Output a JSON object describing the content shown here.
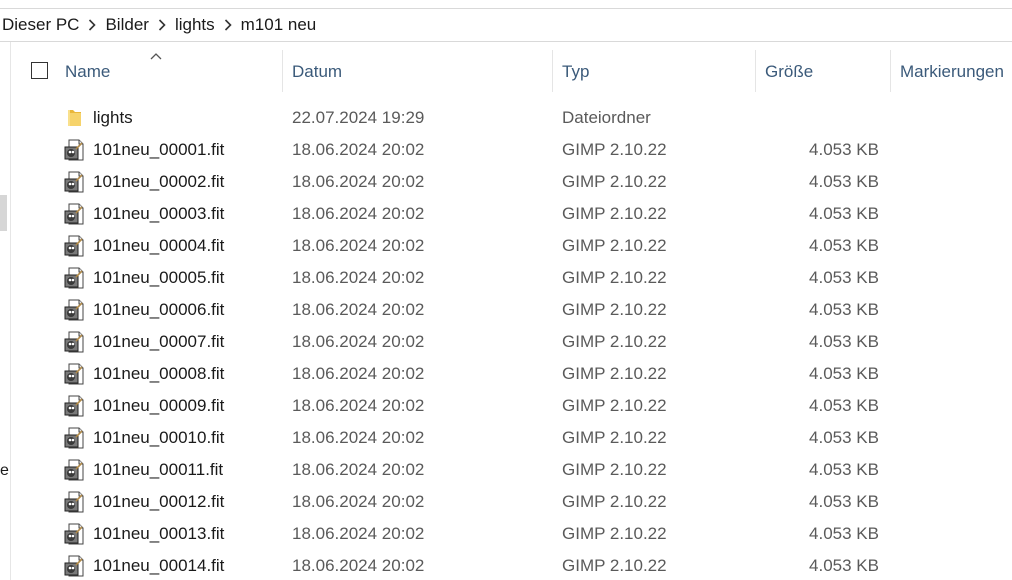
{
  "breadcrumb": {
    "items": [
      "Dieser PC",
      "Bilder",
      "lights",
      "m101 neu"
    ]
  },
  "leftpane": {
    "cut_text": "e"
  },
  "columns": {
    "name": "Name",
    "date": "Datum",
    "type": "Typ",
    "size": "Größe",
    "tags": "Markierungen",
    "sort": "ascending"
  },
  "colors": {
    "header_text": "#3b5a7a",
    "folder_yellow": "#f2c94c",
    "secondary_text": "#5a5a5a"
  },
  "files": [
    {
      "icon": "folder-icon",
      "name": "lights",
      "date": "22.07.2024 19:29",
      "type": "Dateiordner",
      "size": ""
    },
    {
      "icon": "gimp-file-icon",
      "name": "101neu_00001.fit",
      "date": "18.06.2024 20:02",
      "type": "GIMP 2.10.22",
      "size": "4.053 KB"
    },
    {
      "icon": "gimp-file-icon",
      "name": "101neu_00002.fit",
      "date": "18.06.2024 20:02",
      "type": "GIMP 2.10.22",
      "size": "4.053 KB"
    },
    {
      "icon": "gimp-file-icon",
      "name": "101neu_00003.fit",
      "date": "18.06.2024 20:02",
      "type": "GIMP 2.10.22",
      "size": "4.053 KB"
    },
    {
      "icon": "gimp-file-icon",
      "name": "101neu_00004.fit",
      "date": "18.06.2024 20:02",
      "type": "GIMP 2.10.22",
      "size": "4.053 KB"
    },
    {
      "icon": "gimp-file-icon",
      "name": "101neu_00005.fit",
      "date": "18.06.2024 20:02",
      "type": "GIMP 2.10.22",
      "size": "4.053 KB"
    },
    {
      "icon": "gimp-file-icon",
      "name": "101neu_00006.fit",
      "date": "18.06.2024 20:02",
      "type": "GIMP 2.10.22",
      "size": "4.053 KB"
    },
    {
      "icon": "gimp-file-icon",
      "name": "101neu_00007.fit",
      "date": "18.06.2024 20:02",
      "type": "GIMP 2.10.22",
      "size": "4.053 KB"
    },
    {
      "icon": "gimp-file-icon",
      "name": "101neu_00008.fit",
      "date": "18.06.2024 20:02",
      "type": "GIMP 2.10.22",
      "size": "4.053 KB"
    },
    {
      "icon": "gimp-file-icon",
      "name": "101neu_00009.fit",
      "date": "18.06.2024 20:02",
      "type": "GIMP 2.10.22",
      "size": "4.053 KB"
    },
    {
      "icon": "gimp-file-icon",
      "name": "101neu_00010.fit",
      "date": "18.06.2024 20:02",
      "type": "GIMP 2.10.22",
      "size": "4.053 KB"
    },
    {
      "icon": "gimp-file-icon",
      "name": "101neu_00011.fit",
      "date": "18.06.2024 20:02",
      "type": "GIMP 2.10.22",
      "size": "4.053 KB"
    },
    {
      "icon": "gimp-file-icon",
      "name": "101neu_00012.fit",
      "date": "18.06.2024 20:02",
      "type": "GIMP 2.10.22",
      "size": "4.053 KB"
    },
    {
      "icon": "gimp-file-icon",
      "name": "101neu_00013.fit",
      "date": "18.06.2024 20:02",
      "type": "GIMP 2.10.22",
      "size": "4.053 KB"
    },
    {
      "icon": "gimp-file-icon",
      "name": "101neu_00014.fit",
      "date": "18.06.2024 20:02",
      "type": "GIMP 2.10.22",
      "size": "4.053 KB"
    }
  ]
}
